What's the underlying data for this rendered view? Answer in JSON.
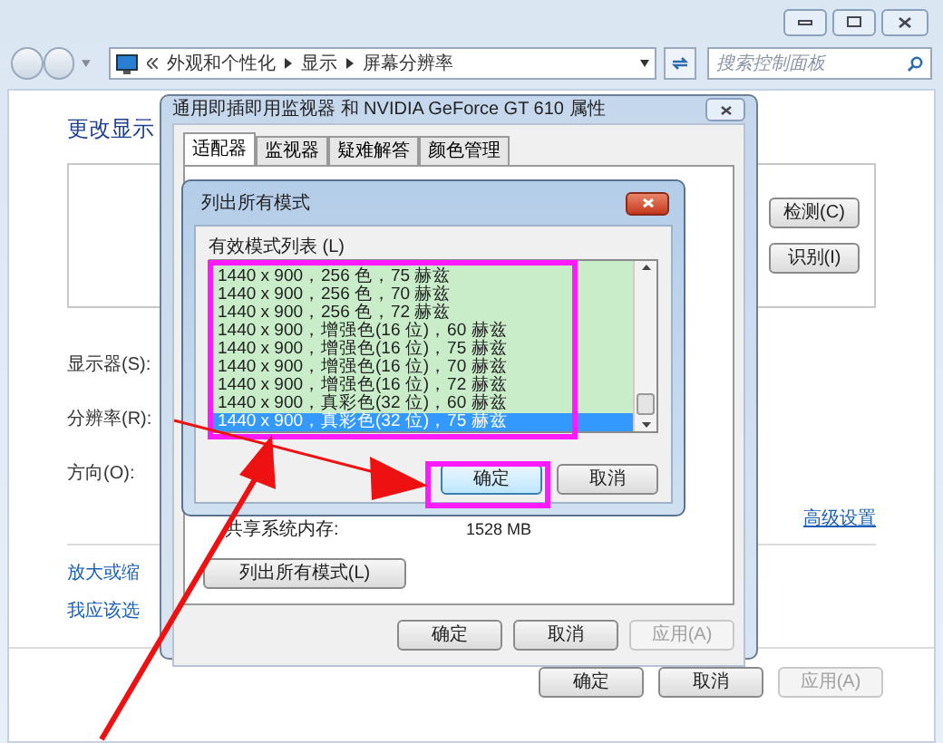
{
  "window": {
    "address_path": [
      "外观和个性化",
      "显示",
      "屏幕分辨率"
    ],
    "search_placeholder": "搜索控制面板",
    "heading": "更改显示",
    "labels": [
      "显示器(S):",
      "分辨率(R):",
      "方向(O):"
    ],
    "side_buttons": [
      "检测(C)",
      "识别(I)"
    ],
    "advanced_link": "高级设置",
    "links": [
      "放大或缩",
      "我应该选"
    ],
    "buttons": [
      {
        "label": "确定",
        "disabled": false
      },
      {
        "label": "取消",
        "disabled": false
      },
      {
        "label": "应用(A)",
        "disabled": true
      }
    ]
  },
  "properties_dialog": {
    "title": "通用即插即用监视器 和 NVIDIA GeForce GT 610 属性",
    "tabs": [
      {
        "label": "适配器",
        "selected": true
      },
      {
        "label": "监视器",
        "selected": false
      },
      {
        "label": "疑难解答",
        "selected": false
      },
      {
        "label": "颜色管理",
        "selected": false
      }
    ],
    "memory_label": "共享系统内存:",
    "memory_value": "1528 MB",
    "list_modes_button": "列出所有模式(L)",
    "buttons": [
      {
        "label": "确定",
        "disabled": false
      },
      {
        "label": "取消",
        "disabled": false
      },
      {
        "label": "应用(A)",
        "disabled": true
      }
    ]
  },
  "modes_dialog": {
    "title": "列出所有模式",
    "list_label": "有效模式列表 (L)",
    "modes": [
      {
        "label": "1440 x 900，256 色，75 赫兹",
        "selected": false
      },
      {
        "label": "1440 x 900，256 色，70 赫兹",
        "selected": false
      },
      {
        "label": "1440 x 900，256 色，72 赫兹",
        "selected": false
      },
      {
        "label": "1440 x 900，增强色(16 位)，60 赫兹",
        "selected": false
      },
      {
        "label": "1440 x 900，增强色(16 位)，75 赫兹",
        "selected": false
      },
      {
        "label": "1440 x 900，增强色(16 位)，70 赫兹",
        "selected": false
      },
      {
        "label": "1440 x 900，增强色(16 位)，72 赫兹",
        "selected": false
      },
      {
        "label": "1440 x 900，真彩色(32 位)，60 赫兹",
        "selected": false
      },
      {
        "label": "1440 x 900，真彩色(32 位)，75 赫兹",
        "selected": true
      }
    ],
    "buttons": [
      {
        "label": "确定",
        "highlighted": true
      },
      {
        "label": "取消",
        "highlighted": false
      }
    ]
  }
}
